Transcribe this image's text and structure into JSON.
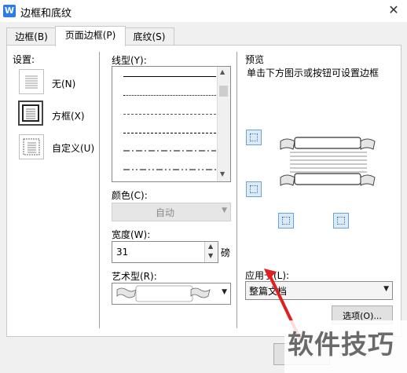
{
  "dialog": {
    "title": "边框和底纹",
    "app_icon": "W"
  },
  "tabs": [
    {
      "label": "边框(B)",
      "active": false
    },
    {
      "label": "页面边框(P)",
      "active": true
    },
    {
      "label": "底纹(S)",
      "active": false
    }
  ],
  "settings": {
    "label": "设置:",
    "items": [
      {
        "label": "无(N)",
        "icon": "none-border-icon",
        "selected": false
      },
      {
        "label": "方框(X)",
        "icon": "box-border-icon",
        "selected": true
      },
      {
        "label": "自定义(U)",
        "icon": "custom-border-icon",
        "selected": false
      }
    ]
  },
  "line_style": {
    "label": "线型(Y):",
    "options": [
      "solid",
      "dotted",
      "dashed-fine",
      "dashed",
      "dash-dot",
      "dash-dot-dot"
    ]
  },
  "color": {
    "label": "颜色(C):",
    "value": "自动"
  },
  "width": {
    "label": "宽度(W):",
    "value": "31",
    "unit": "磅"
  },
  "art": {
    "label": "艺术型(R):"
  },
  "preview": {
    "label": "预览",
    "hint": "单击下方图示或按钮可设置边框"
  },
  "apply": {
    "label": "应用于(L):",
    "value": "整篇文档"
  },
  "buttons": {
    "options": "选项(O)..."
  },
  "watermark": {
    "text": "软件技巧"
  },
  "colors": {
    "accent": "#2b7ce9",
    "selection_border": "#444444",
    "preview_btn": "#dce9f7"
  }
}
